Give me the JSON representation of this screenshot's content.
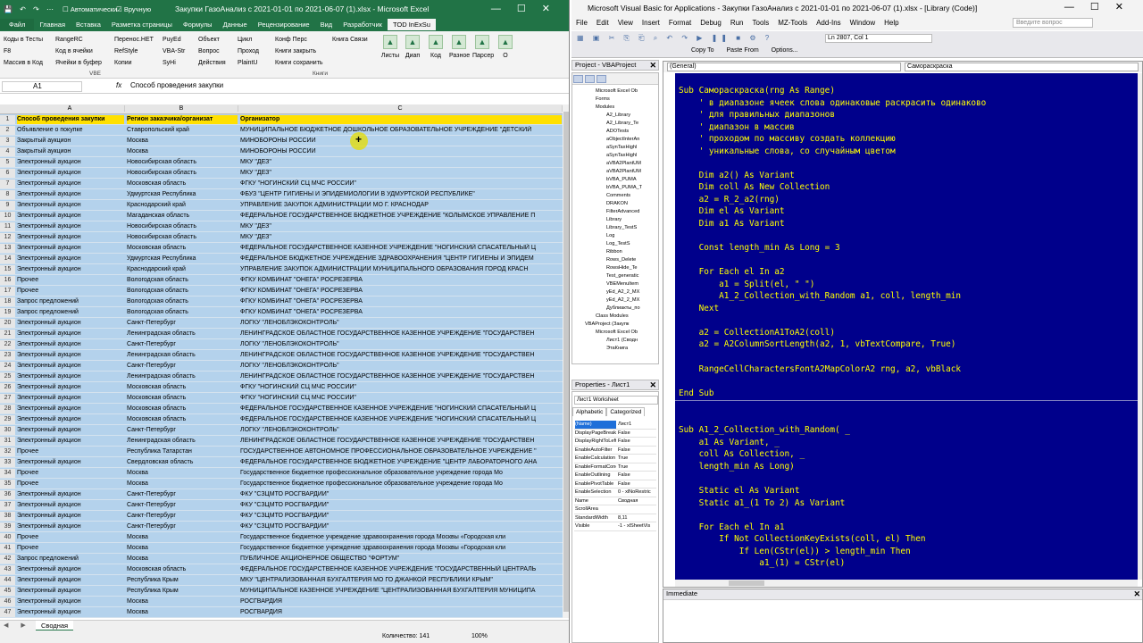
{
  "excel": {
    "qat": "💾 ↶ ↷ ⋯",
    "calc_auto": "Автоматически",
    "calc_manual": "Вручную",
    "title": "Закупки ГазоАнализ с 2021-01-01 по 2021-06-07 (1).xlsx  -  Microsoft Excel",
    "tabs": [
      "Главная",
      "Вставка",
      "Разметка страницы",
      "Формулы",
      "Данные",
      "Рецензирование",
      "Вид",
      "Разработчик",
      "TOD InExSu"
    ],
    "file_tab": "Файл",
    "ribbon_cols": [
      [
        "Коды в Тесты",
        "F8",
        "Массив в Код"
      ],
      [
        "RangeRC",
        "Код в ячейки",
        "Ячейки в буфер"
      ],
      [
        "Перенос.НЕТ",
        "RefStyle",
        "Копии"
      ],
      [
        "PuyEd",
        "VBA-Str",
        "SyHi"
      ],
      [
        "Объект",
        "Вопрос",
        "Действия"
      ],
      [
        "Цикл",
        "Проход",
        "PlaintU"
      ],
      [
        "Конф Перс",
        "Книги закрыть",
        "Книги сохранить"
      ],
      [
        "Книга Связи"
      ]
    ],
    "group_vbe": "VBE",
    "group_books": "Книги",
    "big_buttons": [
      "Листы",
      "Диап",
      "Код",
      "Разное",
      "Парсер",
      "О"
    ],
    "namebox": "A1",
    "fx": "fx",
    "formula_value": "Способ проведения закупки",
    "col_headers": [
      "A",
      "B",
      "C"
    ],
    "headers": [
      "Способ проведения закупки",
      "Регион заказчика/организат",
      "Организатор"
    ],
    "rows": [
      [
        "Объявление о покупке",
        "Ставропольский край",
        "МУНИЦИПАЛЬНОЕ БЮДЖЕТНОЕ ДОШКОЛЬНОЕ ОБРАЗОВАТЕЛЬНОЕ УЧРЕЖДЕНИЕ \"ДЕТСКИЙ"
      ],
      [
        "Закрытый аукцион",
        "Москва",
        "МИНОБОРОНЫ РОССИИ"
      ],
      [
        "Закрытый аукцион",
        "Москва",
        "МИНОБОРОНЫ РОССИИ"
      ],
      [
        "Электронный аукцион",
        "Новосибирская область",
        "МКУ \"ДЕЗ\""
      ],
      [
        "Электронный аукцион",
        "Новосибирская область",
        "МКУ \"ДЕЗ\""
      ],
      [
        "Электронный аукцион",
        "Московская область",
        "ФГКУ \"НОГИНСКИЙ СЦ МЧС РОССИИ\""
      ],
      [
        "Электронный аукцион",
        "Удмуртская Республика",
        "ФБУЗ \"ЦЕНТР ГИГИЕНЫ И ЭПИДЕМИОЛОГИИ В УДМУРТСКОЙ РЕСПУБЛИКЕ\""
      ],
      [
        "Электронный аукцион",
        "Краснодарский край",
        "УПРАВЛЕНИЕ ЗАКУПОК АДМИНИСТРАЦИИ  МО Г. КРАСНОДАР"
      ],
      [
        "Электронный аукцион",
        "Магаданская область",
        "ФЕДЕРАЛЬНОЕ ГОСУДАРСТВЕННОЕ БЮДЖЕТНОЕ УЧРЕЖДЕНИЕ \"КОЛЫМСКОЕ УПРАВЛЕНИЕ П"
      ],
      [
        "Электронный аукцион",
        "Новосибирская область",
        "МКУ \"ДЕЗ\""
      ],
      [
        "Электронный аукцион",
        "Новосибирская область",
        "МКУ \"ДЕЗ\""
      ],
      [
        "Электронный аукцион",
        "Московская область",
        "ФЕДЕРАЛЬНОЕ ГОСУДАРСТВЕННОЕ КАЗЕННОЕ УЧРЕЖДЕНИЕ \"НОГИНСКИЙ СПАСАТЕЛЬНЫЙ Ц"
      ],
      [
        "Электронный аукцион",
        "Удмуртская Республика",
        "ФЕДЕРАЛЬНОЕ БЮДЖЕТНОЕ УЧРЕЖДЕНИЕ ЗДРАВООХРАНЕНИЯ \"ЦЕНТР ГИГИЕНЫ И ЭПИДЕМ"
      ],
      [
        "Электронный аукцион",
        "Краснодарский край",
        "УПРАВЛЕНИЕ ЗАКУПОК АДМИНИСТРАЦИИ МУНИЦИПАЛЬНОГО ОБРАЗОВАНИЯ ГОРОД КРАСН"
      ],
      [
        "Прочее",
        "Вологодская область",
        "ФГКУ КОМБИНАТ \"ОНЕГА\" РОСРЕЗЕРВА"
      ],
      [
        "Прочее",
        "Вологодская область",
        "ФГКУ КОМБИНАТ \"ОНЕГА\" РОСРЕЗЕРВА"
      ],
      [
        "Запрос предложений",
        "Вологодская область",
        "ФГКУ КОМБИНАТ \"ОНЕГА\" РОСРЕЗЕРВА"
      ],
      [
        "Запрос предложений",
        "Вологодская область",
        "ФГКУ КОМБИНАТ \"ОНЕГА\" РОСРЕЗЕРВА"
      ],
      [
        "Электронный аукцион",
        "Санкт-Петербург",
        "ЛОГКУ \"ЛЕНОБЛЭКОКОНТРОЛЬ\""
      ],
      [
        "Электронный аукцион",
        "Ленинградская область",
        "ЛЕНИНГРАДСКОЕ ОБЛАСТНОЕ ГОСУДАРСТВЕННОЕ КАЗЕННОЕ УЧРЕЖДЕНИЕ \"ГОСУДАРСТВЕН"
      ],
      [
        "Электронный аукцион",
        "Санкт-Петербург",
        "ЛОГКУ \"ЛЕНОБЛЭКОКОНТРОЛЬ\""
      ],
      [
        "Электронный аукцион",
        "Ленинградская область",
        "ЛЕНИНГРАДСКОЕ ОБЛАСТНОЕ ГОСУДАРСТВЕННОЕ КАЗЕННОЕ УЧРЕЖДЕНИЕ \"ГОСУДАРСТВЕН"
      ],
      [
        "Электронный аукцион",
        "Санкт-Петербург",
        "ЛОГКУ \"ЛЕНОБЛЭКОКОНТРОЛЬ\""
      ],
      [
        "Электронный аукцион",
        "Ленинградская область",
        "ЛЕНИНГРАДСКОЕ ОБЛАСТНОЕ ГОСУДАРСТВЕННОЕ КАЗЕННОЕ УЧРЕЖДЕНИЕ \"ГОСУДАРСТВЕН"
      ],
      [
        "Электронный аукцион",
        "Московская область",
        "ФГКУ \"НОГИНСКИЙ СЦ МЧС РОССИИ\""
      ],
      [
        "Электронный аукцион",
        "Московская область",
        "ФГКУ \"НОГИНСКИЙ СЦ МЧС РОССИИ\""
      ],
      [
        "Электронный аукцион",
        "Московская область",
        "ФЕДЕРАЛЬНОЕ ГОСУДАРСТВЕННОЕ КАЗЕННОЕ УЧРЕЖДЕНИЕ \"НОГИНСКИЙ СПАСАТЕЛЬНЫЙ Ц"
      ],
      [
        "Электронный аукцион",
        "Московская область",
        "ФЕДЕРАЛЬНОЕ ГОСУДАРСТВЕННОЕ КАЗЕННОЕ УЧРЕЖДЕНИЕ \"НОГИНСКИЙ СПАСАТЕЛЬНЫЙ Ц"
      ],
      [
        "Электронный аукцион",
        "Санкт-Петербург",
        "ЛОГКУ \"ЛЕНОБЛЭКОКОНТРОЛЬ\""
      ],
      [
        "Электронный аукцион",
        "Ленинградская область",
        "ЛЕНИНГРАДСКОЕ ОБЛАСТНОЕ ГОСУДАРСТВЕННОЕ КАЗЕННОЕ УЧРЕЖДЕНИЕ \"ГОСУДАРСТВЕН"
      ],
      [
        "Прочее",
        "Республика Татарстан",
        "ГОСУДАРСТВЕННОЕ АВТОНОМНОЕ ПРОФЕССИОНАЛЬНОЕ ОБРАЗОВАТЕЛЬНОЕ УЧРЕЖДЕНИЕ \""
      ],
      [
        "Электронный аукцион",
        "Свердловская область",
        "ФЕДЕРАЛЬНОЕ ГОСУДАРСТВЕННОЕ БЮДЖЕТНОЕ УЧРЕЖДЕНИЕ \"ЦЕНТР ЛАБОРАТОРНОГО АНА"
      ],
      [
        "Прочее",
        "Москва",
        "Государственное бюджетное профессиональное образовательное учреждение города Мо"
      ],
      [
        "Прочее",
        "Москва",
        "Государственное бюджетное профессиональное образовательное учреждение города Мо"
      ],
      [
        "Электронный аукцион",
        "Санкт-Петербург",
        "ФКУ \"СЗЦМТО РОСГВАРДИИ\""
      ],
      [
        "Электронный аукцион",
        "Санкт-Петербург",
        "ФКУ \"СЗЦМТО РОСГВАРДИИ\""
      ],
      [
        "Электронный аукцион",
        "Санкт-Петербург",
        "ФКУ \"СЗЦМТО РОСГВАРДИИ\""
      ],
      [
        "Электронный аукцион",
        "Санкт-Петербург",
        "ФКУ \"СЗЦМТО РОСГВАРДИИ\""
      ],
      [
        "Прочее",
        "Москва",
        "Государственное бюджетное учреждение здравоохранения города Москвы «Городская кли"
      ],
      [
        "Прочее",
        "Москва",
        "Государственное бюджетное учреждение здравоохранения города Москвы «Городская кли"
      ],
      [
        "Запрос предложений",
        "Москва",
        "ПУБЛИЧНОЕ АКЦИОНЕРНОЕ ОБЩЕСТВО \"ФОРТУМ\""
      ],
      [
        "Электронный аукцион",
        "Московская область",
        "ФЕДЕРАЛЬНОЕ ГОСУДАРСТВЕННОЕ КАЗЕННОЕ УЧРЕЖДЕНИЕ \"ГОСУДАРСТВЕННЫЙ ЦЕНТРАЛЬ"
      ],
      [
        "Электронный аукцион",
        "Республика Крым",
        "МКУ \"ЦЕНТРАЛИЗОВАННАЯ БУХГАЛТЕРИЯ МО ГО ДЖАНКОЙ РЕСПУБЛИКИ КРЫМ\""
      ],
      [
        "Электронный аукцион",
        "Республика Крым",
        "МУНИЦИПАЛЬНОЕ КАЗЕННОЕ УЧРЕЖДЕНИЕ \"ЦЕНТРАЛИЗОВАННАЯ БУХГАЛТЕРИЯ МУНИЦИПА"
      ],
      [
        "Электронный аукцион",
        "Москва",
        "РОСГВАРДИЯ"
      ],
      [
        "Электронный аукцион",
        "Москва",
        "РОСГВАРДИЯ"
      ]
    ],
    "sheet_nav": "◀ ▶",
    "sheet_tab": "Сводная",
    "status_count": "Количество: 141",
    "status_zoom": "100%"
  },
  "vba": {
    "title": "Microsoft Visual Basic for Applications - Закупки ГазоАнализ с 2021-01-01 по 2021-06-07 (1).xlsx - [Library (Code)]",
    "menu": [
      "File",
      "Edit",
      "View",
      "Insert",
      "Format",
      "Debug",
      "Run",
      "Tools",
      "MZ-Tools",
      "Add-Ins",
      "Window",
      "Help"
    ],
    "ask_placeholder": "Введите вопрос",
    "toolbar_icons": "▦ ▣ ✂ ⎘ ⎗ ⌕ ↶ ↷ ▶ ❚❚ ■ ⚙ ?",
    "ln_col": "Ln 2807, Col 1",
    "toolbar2": [
      "Copy To",
      "Paste From",
      "Options..."
    ],
    "project_title": "Project - VBAProject",
    "tree": [
      "Microsoft Excel Ob",
      "Forms",
      "Modules",
      "A2_Library",
      "A2_Library_Te",
      "ADOTests",
      "aObjectInterAn",
      "aSynTaxHighl",
      "aSynTaxHighl",
      "aVBA2PlantUM",
      "aVBA2PlantUM",
      "bVBA_PUMA",
      "bVBA_PUMA_T",
      "Comments",
      "DRAKON",
      "FilterAdvanced",
      "Library",
      "Library_TestS",
      "Log",
      "Log_TestS",
      "Ribbon",
      "Rows_Delete",
      "RowsHide_Te",
      "Test_generatic",
      "VBEMenuItem",
      "yEd_A2_2_MX",
      "yEd_A2_2_MX",
      "Дублиакты_по",
      "Class Modules",
      "VBAProject (Закупк",
      "Microsoft Excel Ob",
      "Лист1 (Сводн",
      "ЭтаКнига"
    ],
    "props_title": "Properties - Лист1",
    "props_sel": "Лист1 Worksheet",
    "props_tabs": [
      "Alphabetic",
      "Categorized"
    ],
    "props": [
      [
        "(Name)",
        "Лист1"
      ],
      [
        "DisplayPageBreaks",
        "False"
      ],
      [
        "DisplayRightToLeft",
        "False"
      ],
      [
        "EnableAutoFilter",
        "False"
      ],
      [
        "EnableCalculation",
        "True"
      ],
      [
        "EnableFormatConditions",
        "True"
      ],
      [
        "EnableOutlining",
        "False"
      ],
      [
        "EnablePivotTable",
        "False"
      ],
      [
        "EnableSelection",
        "0 - xlNoRestric"
      ],
      [
        "Name",
        "Сводная"
      ],
      [
        "ScrollArea",
        ""
      ],
      [
        "StandardWidth",
        "8,11"
      ],
      [
        "Visible",
        "-1 - xlSheetVis"
      ]
    ],
    "combo_left": "(General)",
    "combo_right": "Самораскраска",
    "code_block1": [
      "Sub Самораскраска(rng As Range)",
      "    ' в диапазоне ячеек слова одинаковые раскрасить одинаково",
      "    ' для правильных диапазонов",
      "    ' диапазон в массив",
      "    ' проходом по массиву создать коллекцию",
      "    ' уникальные слова, со случайным цветом",
      "",
      "    Dim a2() As Variant",
      "    Dim coll As New Collection",
      "    a2 = R_2_a2(rng)",
      "    Dim el As Variant",
      "    Dim a1 As Variant",
      "",
      "    Const length_min As Long = 3",
      "",
      "    For Each el In a2",
      "        a1 = Split(el, \" \")",
      "        A1_2_Collection_with_Random a1, coll, length_min",
      "    Next",
      "",
      "    a2 = CollectionA1ToA2(coll)",
      "    a2 = A2ColumnSortLength(a2, 1, vbTextCompare, True)",
      "",
      "    RangeCellCharactersFontA2MapColorA2 rng, a2, vbBlack",
      "",
      "End Sub"
    ],
    "code_block2": [
      "",
      "",
      "Sub A1_2_Collection_with_Random( _",
      "    a1 As Variant, _",
      "    coll As Collection, _",
      "    length_min As Long)",
      "",
      "    Static el As Variant",
      "    Static a1_(1 To 2) As Variant",
      "",
      "    For Each el In a1",
      "        If Not CollectionKeyExists(coll, el) Then",
      "            If Len(CStr(el)) > length_min Then",
      "                a1_(1) = CStr(el)"
    ],
    "immediate_title": "Immediate"
  }
}
